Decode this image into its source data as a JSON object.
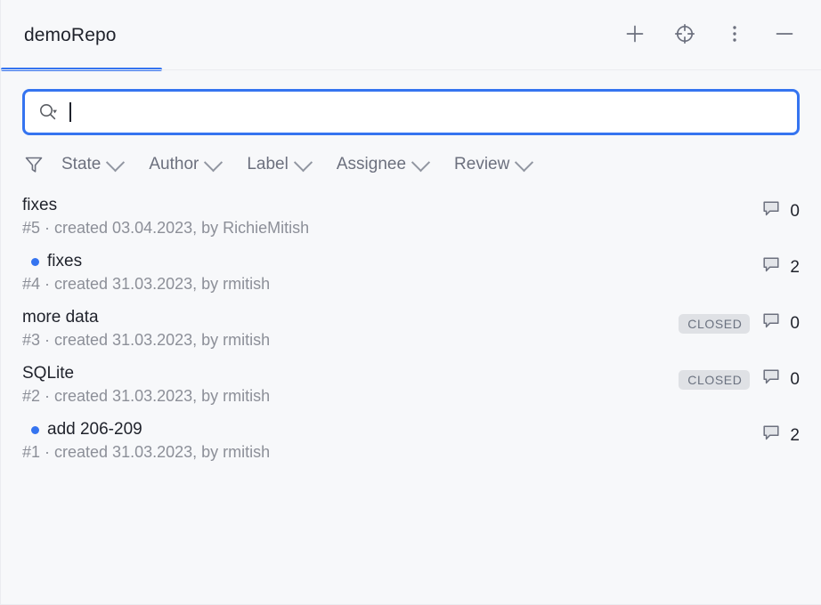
{
  "window": {
    "tab_title": "demoRepo",
    "accent_color": "#3574f0",
    "background_color": "#f7f8fa"
  },
  "toolbar": {
    "buttons": [
      {
        "name": "add-icon",
        "label": "+"
      },
      {
        "name": "target-icon",
        "label": "Select in list"
      },
      {
        "name": "more-options-icon",
        "label": "More"
      },
      {
        "name": "minimize-icon",
        "label": "Hide"
      }
    ]
  },
  "search": {
    "value": "",
    "placeholder": "",
    "icon": "search-icon-with-dropdown"
  },
  "filters": {
    "icon": "filter-funnel-icon",
    "items": [
      {
        "label": "State"
      },
      {
        "label": "Author"
      },
      {
        "label": "Label"
      },
      {
        "label": "Assignee"
      },
      {
        "label": "Review"
      }
    ]
  },
  "list": {
    "rows": [
      {
        "unread": false,
        "title": "fixes",
        "subtitle": "#5 · created 03.04.2023, by RichieMitish",
        "badge": "",
        "comments": "0"
      },
      {
        "unread": true,
        "title": "fixes",
        "subtitle": "#4 · created 31.03.2023, by rmitish",
        "badge": "",
        "comments": "2"
      },
      {
        "unread": false,
        "title": "more data",
        "subtitle": "#3 · created 31.03.2023, by rmitish",
        "badge": "CLOSED",
        "comments": "0"
      },
      {
        "unread": false,
        "title": "SQLite",
        "subtitle": "#2 · created 31.03.2023, by rmitish",
        "badge": "CLOSED",
        "comments": "0"
      },
      {
        "unread": true,
        "title": "add 206-209",
        "subtitle": "#1 · created 31.03.2023, by rmitish",
        "badge": "",
        "comments": "2"
      }
    ]
  }
}
